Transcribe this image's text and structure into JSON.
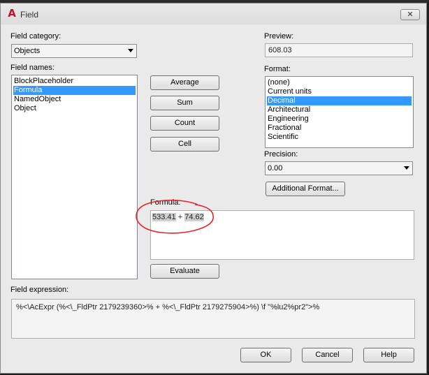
{
  "window": {
    "title": "Field",
    "close_label": "✕"
  },
  "field_category": {
    "label": "Field category:",
    "value": "Objects"
  },
  "field_names": {
    "label": "Field names:",
    "items": [
      "BlockPlaceholder",
      "Formula",
      "NamedObject",
      "Object"
    ],
    "selected": 1
  },
  "buttons": {
    "average": "Average",
    "sum": "Sum",
    "count": "Count",
    "cell": "Cell",
    "evaluate": "Evaluate"
  },
  "preview": {
    "label": "Preview:",
    "value": "608.03"
  },
  "format": {
    "label": "Format:",
    "items": [
      "(none)",
      "Current units",
      "Decimal",
      "Architectural",
      "Engineering",
      "Fractional",
      "Scientific"
    ],
    "selected": 2
  },
  "precision": {
    "label": "Precision:",
    "value": "0.00"
  },
  "additional_format": {
    "label": "Additional Format..."
  },
  "formula": {
    "label": "Formula:",
    "term1": "533.41",
    "operator": " + ",
    "term2": "74.62"
  },
  "field_expression": {
    "label": "Field expression:",
    "value": "%<\\AcExpr (%<\\_FldPtr 2179239360>% + %<\\_FldPtr 2179275904>%) \\f \"%lu2%pr2\">%"
  },
  "footer": {
    "ok": "OK",
    "cancel": "Cancel",
    "help": "Help"
  },
  "colors": {
    "selection": "#3399ff",
    "annotation": "#e8232a"
  }
}
